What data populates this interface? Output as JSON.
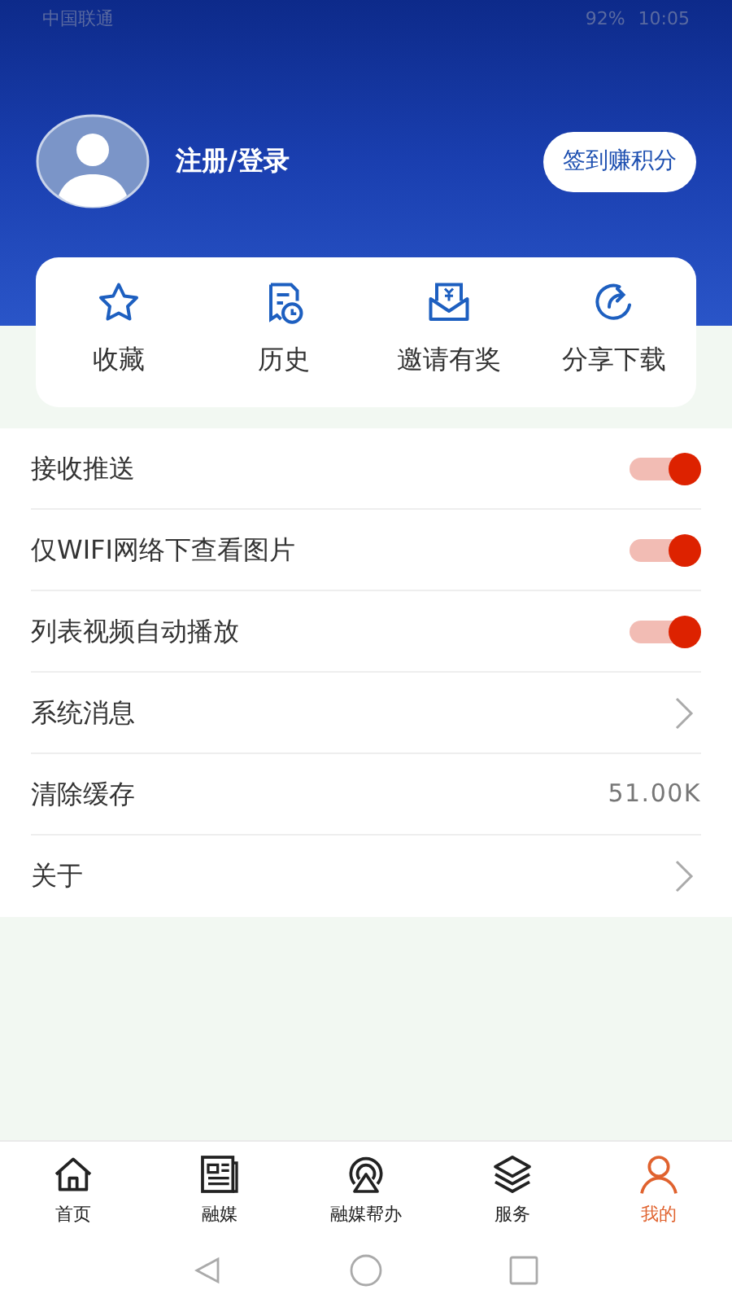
{
  "status_bar": {
    "carrier": "中国联通",
    "battery": "92%",
    "time": "10:05"
  },
  "profile": {
    "login": "注册/登录",
    "checkin_button": "签到赚积分"
  },
  "shortcuts": [
    {
      "label": "收藏"
    },
    {
      "label": "历史"
    },
    {
      "label": "邀请有奖"
    },
    {
      "label": "分享下载"
    }
  ],
  "settings": [
    {
      "kind": "toggle",
      "label": "接收推送",
      "on": true
    },
    {
      "kind": "toggle",
      "label": "仅WIFI网络下查看图片",
      "on": true
    },
    {
      "kind": "toggle",
      "label": "列表视频自动播放",
      "on": true
    },
    {
      "kind": "link",
      "label": "系统消息"
    },
    {
      "kind": "value",
      "label": "清除缓存",
      "value": "51.00K"
    },
    {
      "kind": "link",
      "label": "关于"
    }
  ],
  "tab_bar": [
    {
      "label": "首页",
      "selected": false
    },
    {
      "label": "融媒",
      "selected": false
    },
    {
      "label": "融媒帮办",
      "selected": false
    },
    {
      "label": "服务",
      "selected": false
    },
    {
      "label": "我的",
      "selected": true
    }
  ]
}
